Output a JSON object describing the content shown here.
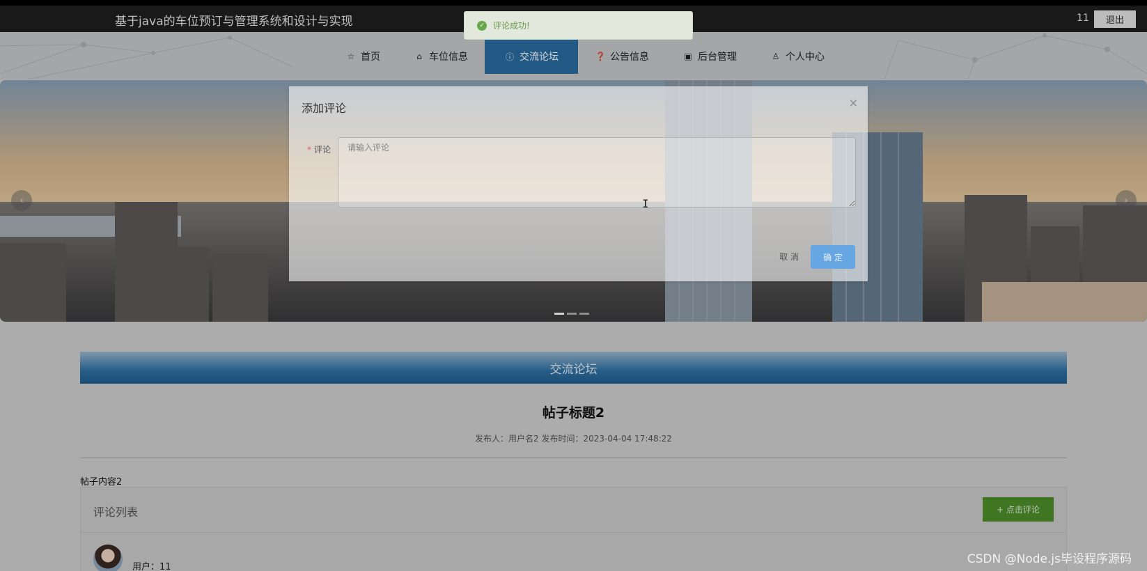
{
  "header": {
    "site_title": "基于java的车位预订与管理系统和设计与实现",
    "user_name": "11",
    "logout_label": "退出"
  },
  "nav": {
    "items": [
      {
        "label": "首页",
        "icon": "star-icon",
        "glyph": "☆"
      },
      {
        "label": "车位信息",
        "icon": "bag-icon",
        "glyph": "⌂"
      },
      {
        "label": "交流论坛",
        "icon": "info-icon",
        "glyph": "ⓘ",
        "active": true
      },
      {
        "label": "公告信息",
        "icon": "question-icon",
        "glyph": "❓"
      },
      {
        "label": "后台管理",
        "icon": "briefcase-icon",
        "glyph": "▣"
      },
      {
        "label": "个人中心",
        "icon": "user-icon",
        "glyph": "♙"
      }
    ],
    "active_color": "#2a6ea3"
  },
  "toast": {
    "text": "评论成功!",
    "icon": "check-circle-icon",
    "color": "#67a84a"
  },
  "dialog": {
    "title": "添加评论",
    "close_glyph": "×",
    "field_label": "评论",
    "required_mark": "*",
    "placeholder": "请输入评论",
    "cancel_label": "取 消",
    "confirm_label": "确 定",
    "confirm_color": "#66a6e3"
  },
  "main": {
    "section_title": "交流论坛",
    "post_title": "帖子标题2",
    "post_meta": "发布人：用户名2  发布时间：2023-04-04 17:48:22",
    "post_content": "帖子内容2",
    "comments": {
      "title": "评论列表",
      "add_button_label": "+ 点击评论",
      "add_button_color": "#4f8f2a",
      "items": [
        {
          "user_label": "用户：11"
        }
      ]
    }
  },
  "carousel": {
    "prev_glyph": "‹",
    "next_glyph": "›"
  },
  "watermark": "CSDN @Node.js毕设程序源码"
}
